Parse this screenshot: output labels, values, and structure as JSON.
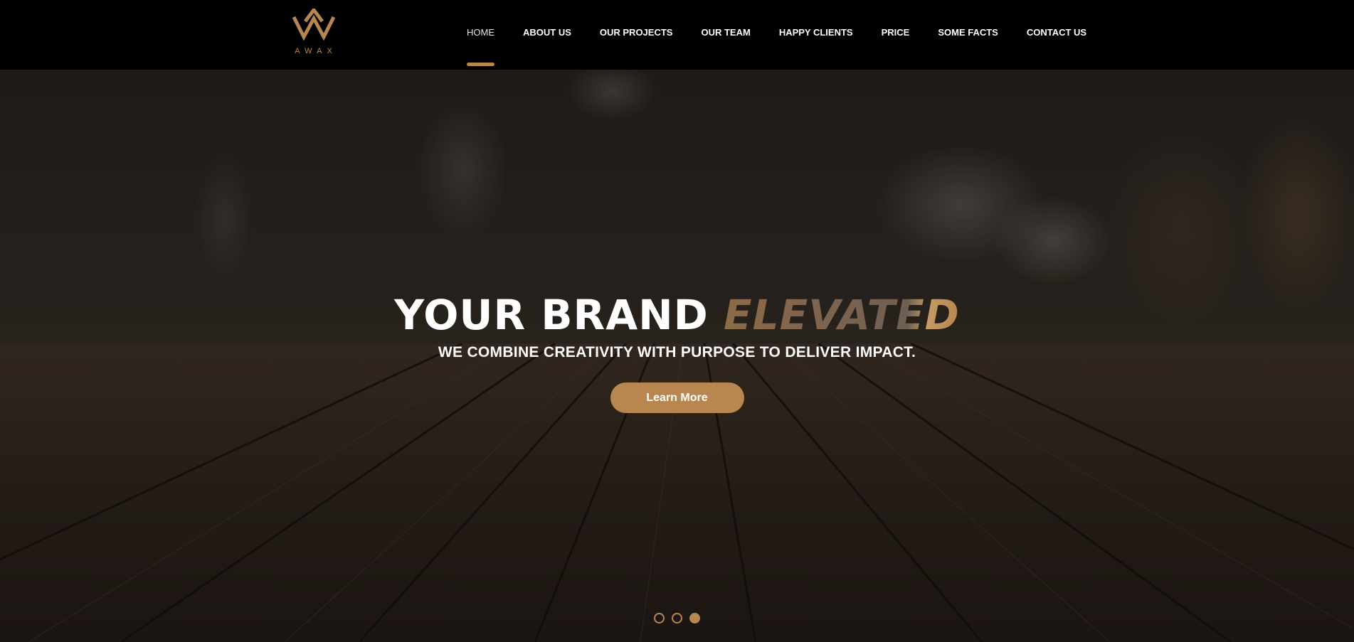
{
  "brand": {
    "logo_text": "AWAX",
    "accent_color": "#b8874f",
    "logo_icon": "crown-w-monogram-icon"
  },
  "nav": {
    "items": [
      {
        "label": "HOME",
        "active": true
      },
      {
        "label": "ABOUT US"
      },
      {
        "label": "OUR PROJECTS"
      },
      {
        "label": "OUR TEAM"
      },
      {
        "label": "HAPPY CLIENTS"
      },
      {
        "label": "PRICE"
      },
      {
        "label": "SOME FACTS"
      },
      {
        "label": "CONTACT US"
      }
    ]
  },
  "hero": {
    "title_main": "YOUR BRAND",
    "title_accent": "ELEVATED",
    "subtitle": "WE COMBINE CREATIVITY WITH PURPOSE TO DELIVER IMPACT.",
    "cta_label": "Learn More",
    "slides_total": 3,
    "slides_active": 3
  }
}
